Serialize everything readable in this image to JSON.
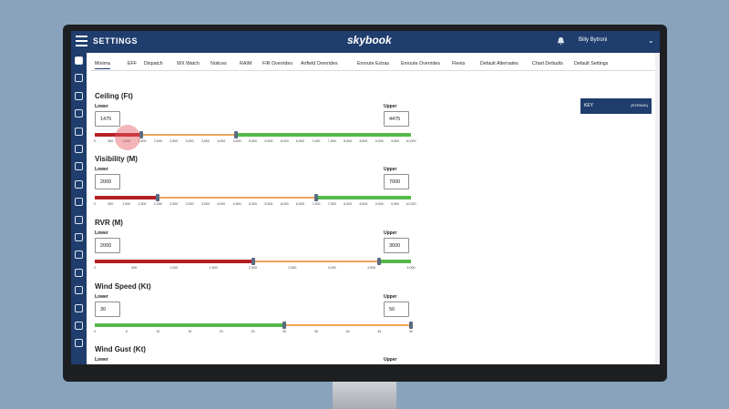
{
  "header": {
    "title": "SETTINGS",
    "logo": "skybook",
    "logo_sub": "",
    "user": "Billy Bytroni"
  },
  "tabs": [
    "Minima",
    "EFF",
    "Dispatch",
    "WX Watch",
    "Notices",
    "RAIM",
    "FIR Overrides",
    "Airfield Overrides",
    "Enroute Extras",
    "Enroute Overrides",
    "Fleets",
    "Default Alternates",
    "Chart Defaults",
    "Default Settings"
  ],
  "active_tab": "Minima",
  "key": {
    "label": "KEY",
    "expand": "(EXPAND)"
  },
  "colors": {
    "red": "#b52025",
    "orange": "#f0a55a",
    "green": "#55b84a",
    "navy": "#1f3d6d"
  },
  "sections": [
    {
      "title": "Ceiling (Ft)",
      "lower_label": "Lower",
      "upper_label": "Upper",
      "lower": "1475",
      "upper": "4475",
      "min": 0,
      "max": 10000,
      "lower_value": 1475,
      "upper_value": 4475,
      "ticks": [
        "0",
        "500",
        "1,000",
        "1,500",
        "2,000",
        "2,500",
        "3,000",
        "3,500",
        "4,000",
        "4,500",
        "5,000",
        "5,500",
        "6,000",
        "6,500",
        "7,000",
        "7,500",
        "8,000",
        "8,500",
        "9,000",
        "9,500",
        "10,000"
      ]
    },
    {
      "title": "Visibility (M)",
      "lower_label": "Lower",
      "upper_label": "Upper",
      "lower": "2000",
      "upper": "7000",
      "min": 0,
      "max": 10000,
      "lower_value": 2000,
      "upper_value": 7000,
      "ticks": [
        "0",
        "500",
        "1,000",
        "1,500",
        "2,000",
        "2,500",
        "3,000",
        "3,500",
        "4,000",
        "4,500",
        "5,000",
        "5,500",
        "6,000",
        "6,500",
        "7,000",
        "7,500",
        "8,000",
        "8,500",
        "9,000",
        "9,500",
        "10,000"
      ]
    },
    {
      "title": "RVR (M)",
      "lower_label": "Lower",
      "upper_label": "Upper",
      "lower": "2000",
      "upper": "3600",
      "min": 0,
      "max": 4000,
      "lower_value": 2000,
      "upper_value": 3600,
      "ticks": [
        "0",
        "500",
        "1,000",
        "1,500",
        "2,000",
        "2,500",
        "3,000",
        "3,500",
        "4,000"
      ]
    },
    {
      "title": "Wind Speed (Kt)",
      "lower_label": "Lower",
      "upper_label": "Upper",
      "lower": "30",
      "upper": "50",
      "min": 0,
      "max": 50,
      "lower_value": 30,
      "upper_value": 50,
      "ticks": [
        "0",
        "5",
        "10",
        "15",
        "20",
        "25",
        "30",
        "35",
        "40",
        "45",
        "50"
      ],
      "reverse": true
    },
    {
      "title": "Wind Gust (Kt)",
      "lower_label": "Lower",
      "upper_label": "Upper"
    }
  ]
}
